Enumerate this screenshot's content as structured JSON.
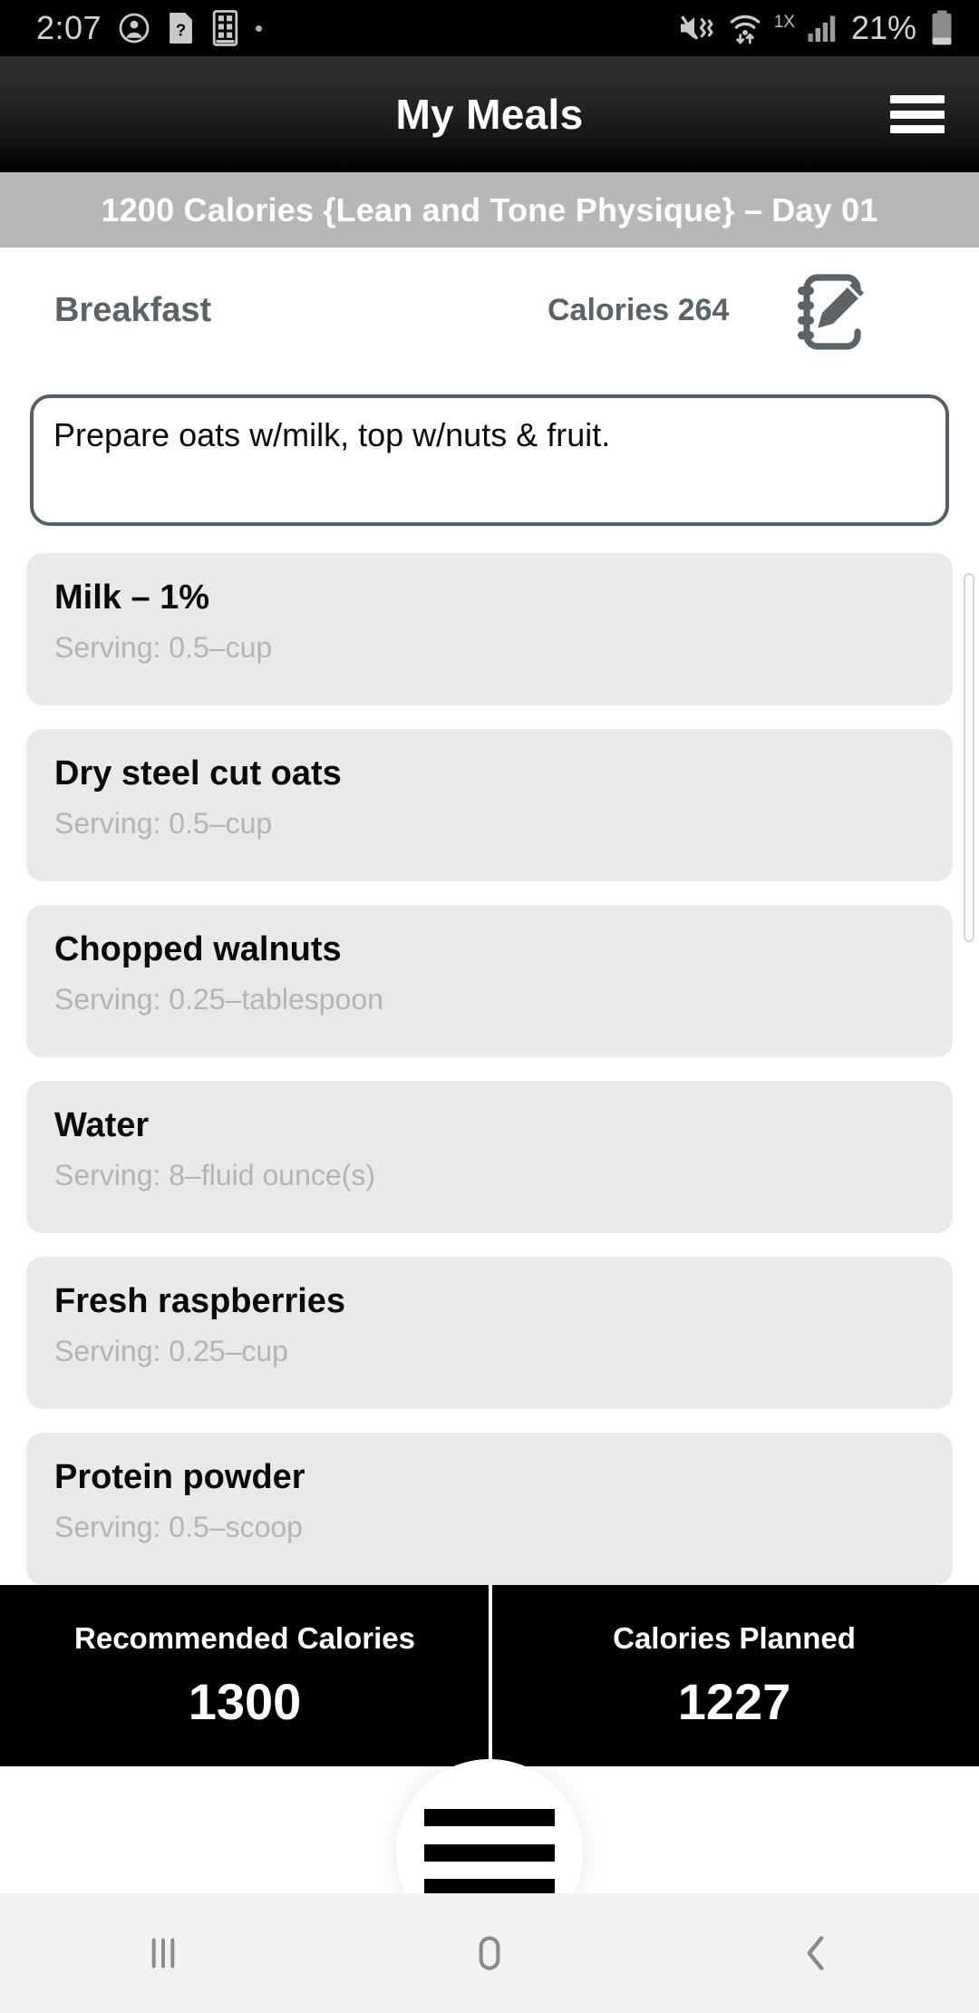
{
  "status_bar": {
    "time": "2:07",
    "left_icons": [
      "account-circle-icon",
      "sim-question-icon",
      "phone-grid-icon",
      "small-dot-icon"
    ],
    "network_mode": "1X",
    "battery_percent": "21%",
    "right_icons": [
      "volume-mute-vibrate-icon",
      "wifi-transfer-icon",
      "signal-bars-icon",
      "battery-icon"
    ]
  },
  "app_bar": {
    "title": "My Meals",
    "menu_icon": "hamburger-menu-icon"
  },
  "plan_bar": {
    "text": "1200 Calories {Lean and Tone Physique} – Day 01"
  },
  "meal_header": {
    "meal_name": "Breakfast",
    "calories_label": "Calories 264",
    "edit_icon": "notepad-pencil-edit-icon"
  },
  "note": {
    "value": "Prepare oats w/milk, top w/nuts & fruit.",
    "placeholder": "Prepare oats w/milk, top w/nuts & fruit."
  },
  "food_items": [
    {
      "name": "Milk – 1%",
      "serving": "Serving: 0.5–cup"
    },
    {
      "name": "Dry steel cut oats",
      "serving": "Serving: 0.5–cup"
    },
    {
      "name": "Chopped walnuts",
      "serving": "Serving: 0.25–tablespoon"
    },
    {
      "name": "Water",
      "serving": "Serving: 8–fluid ounce(s)"
    },
    {
      "name": "Fresh raspberries",
      "serving": "Serving: 0.25–cup"
    },
    {
      "name": "Protein powder",
      "serving": "Serving: 0.5–scoop"
    }
  ],
  "calorie_footer": {
    "recommended_label": "Recommended Calories",
    "recommended_value": "1300",
    "planned_label": "Calories Planned",
    "planned_value": "1227"
  },
  "fab": {
    "icon": "hamburger-menu-icon"
  },
  "nav_bar": {
    "recents_icon": "recents-icon",
    "home_icon": "home-icon",
    "back_icon": "back-chevron-icon"
  },
  "colors": {
    "app_bar_bg": "#000000",
    "plan_bar_bg": "#b7b7b7",
    "card_bg": "#e9e9e9",
    "meal_header_text": "#5c6266",
    "serving_text": "#b4b4b4",
    "note_border": "#565f63",
    "footer_bg": "#000000",
    "nav_bar_bg": "#f2f2f2"
  }
}
